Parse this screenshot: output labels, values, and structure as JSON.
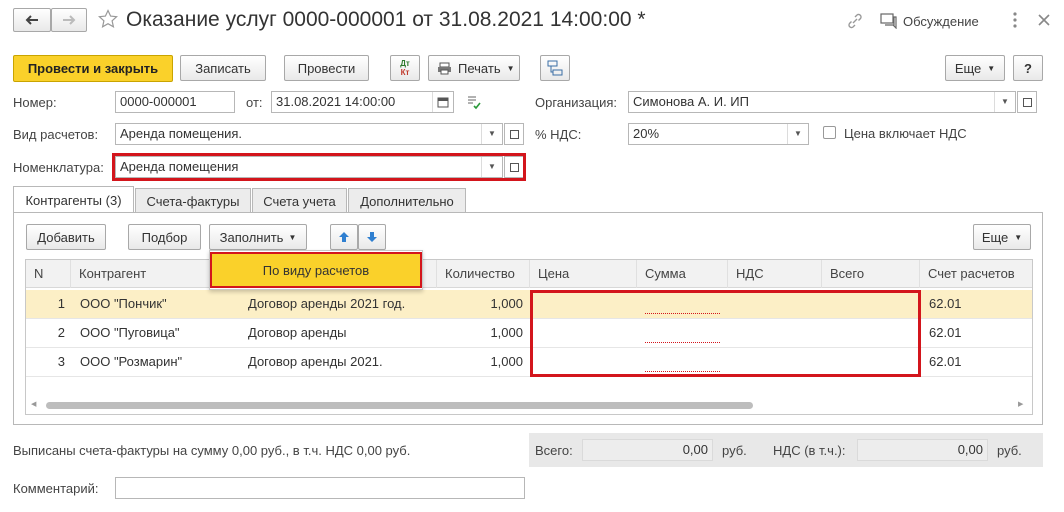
{
  "title": "Оказание услуг 0000-000001 от 31.08.2021 14:00:00 *",
  "header": {
    "discussion_label": "Обсуждение"
  },
  "toolbar": {
    "post_close": "Провести и закрыть",
    "save": "Записать",
    "post": "Провести",
    "print": "Печать",
    "more": "Еще",
    "help": "?",
    "dtkt_top": "Дт",
    "dtkt_bottom": "Кт"
  },
  "form": {
    "number_label": "Номер:",
    "number_value": "0000-000001",
    "date_label": "от:",
    "date_value": "31.08.2021 14:00:00",
    "org_label": "Организация:",
    "org_value": "Симонова А. И. ИП",
    "calc_type_label": "Вид расчетов:",
    "calc_type_value": "Аренда помещения.",
    "vat_label": "% НДС:",
    "vat_value": "20%",
    "price_incl_vat_label": "Цена включает НДС",
    "nomenclature_label": "Номенклатура:",
    "nomenclature_value": "Аренда помещения"
  },
  "tabs": [
    "Контрагенты (3)",
    "Счета-фактуры",
    "Счета учета",
    "Дополнительно"
  ],
  "table_toolbar": {
    "add": "Добавить",
    "select": "Подбор",
    "fill": "Заполнить",
    "more": "Еще",
    "fill_menu_item": "По виду расчетов"
  },
  "table": {
    "columns": [
      "N",
      "Контрагент",
      "Количество",
      "Цена",
      "Сумма",
      "НДС",
      "Всего",
      "Счет расчетов"
    ],
    "rows": [
      {
        "n": "1",
        "contractor": "ООО \"Пончик\"",
        "contract": "Договор аренды 2021 год.",
        "qty": "1,000",
        "account": "62.01"
      },
      {
        "n": "2",
        "contractor": "ООО \"Пуговица\"",
        "contract": "Договор аренды",
        "qty": "1,000",
        "account": "62.01"
      },
      {
        "n": "3",
        "contractor": "ООО \"Розмарин\"",
        "contract": "Договор аренды 2021.",
        "qty": "1,000",
        "account": "62.01"
      }
    ]
  },
  "footer": {
    "invoice_text": "Выписаны счета-фактуры на сумму 0,00 руб., в т.ч. НДС 0,00 руб.",
    "total_label": "Всего:",
    "total_value": "0,00",
    "currency": "руб.",
    "vat_incl_label": "НДС (в т.ч.):",
    "vat_value": "0,00",
    "comment_label": "Комментарий:",
    "comment_value": ""
  },
  "colors": {
    "accent": "#fad12a",
    "highlight_row": "#fcefc6",
    "annotation_red": "#d3151c"
  }
}
